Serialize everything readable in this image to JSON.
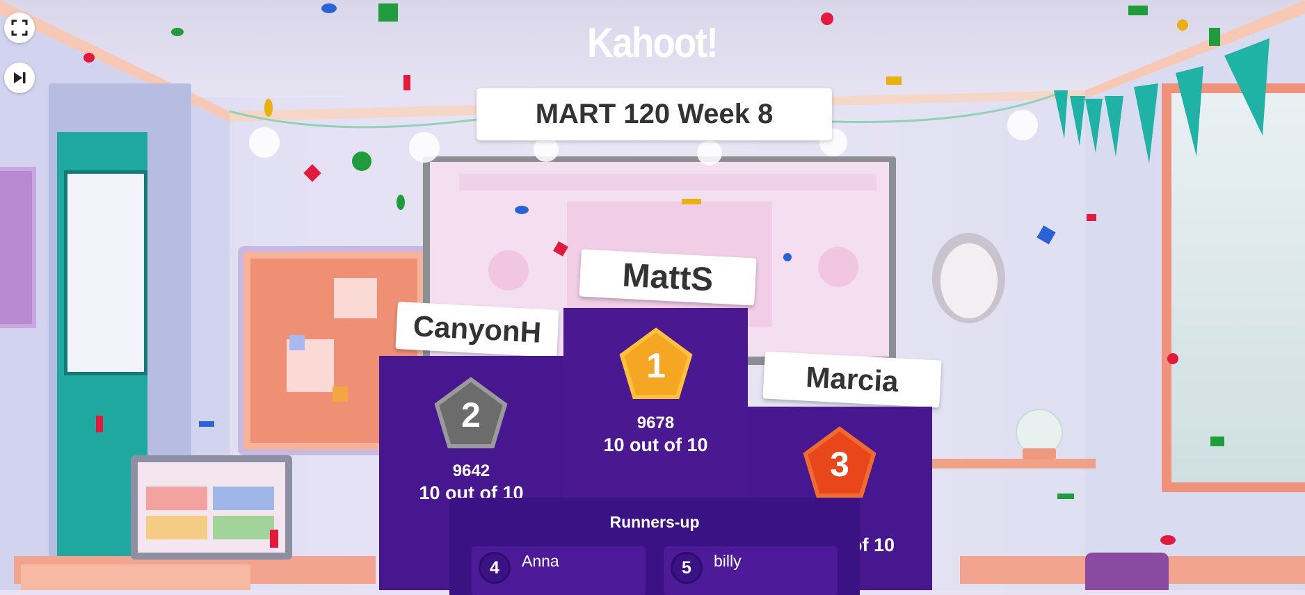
{
  "app": {
    "logo_text": "Kahoot!",
    "quiz_title": "MART 120 Week 8"
  },
  "controls": {
    "fullscreen_icon": "fullscreen-icon",
    "skip_icon": "skip-forward-icon"
  },
  "podium": {
    "first": {
      "rank": "1",
      "name": "MattS",
      "score": "9678",
      "correct": "10 out of 10",
      "badge_color": "#f5a623"
    },
    "second": {
      "rank": "2",
      "name": "CanyonH",
      "score": "9642",
      "correct": "10 out of 10",
      "badge_color": "#7a7a7a"
    },
    "third": {
      "rank": "3",
      "name": "Marcia",
      "score": "",
      "correct": "of 10",
      "badge_color": "#e8471c"
    }
  },
  "runners_up": {
    "title": "Runners-up",
    "items": [
      {
        "rank": "4",
        "name": "Anna"
      },
      {
        "rank": "5",
        "name": "billy"
      }
    ]
  },
  "colors": {
    "podium_purple": "#46178f",
    "runners_bg": "#3a1283"
  }
}
